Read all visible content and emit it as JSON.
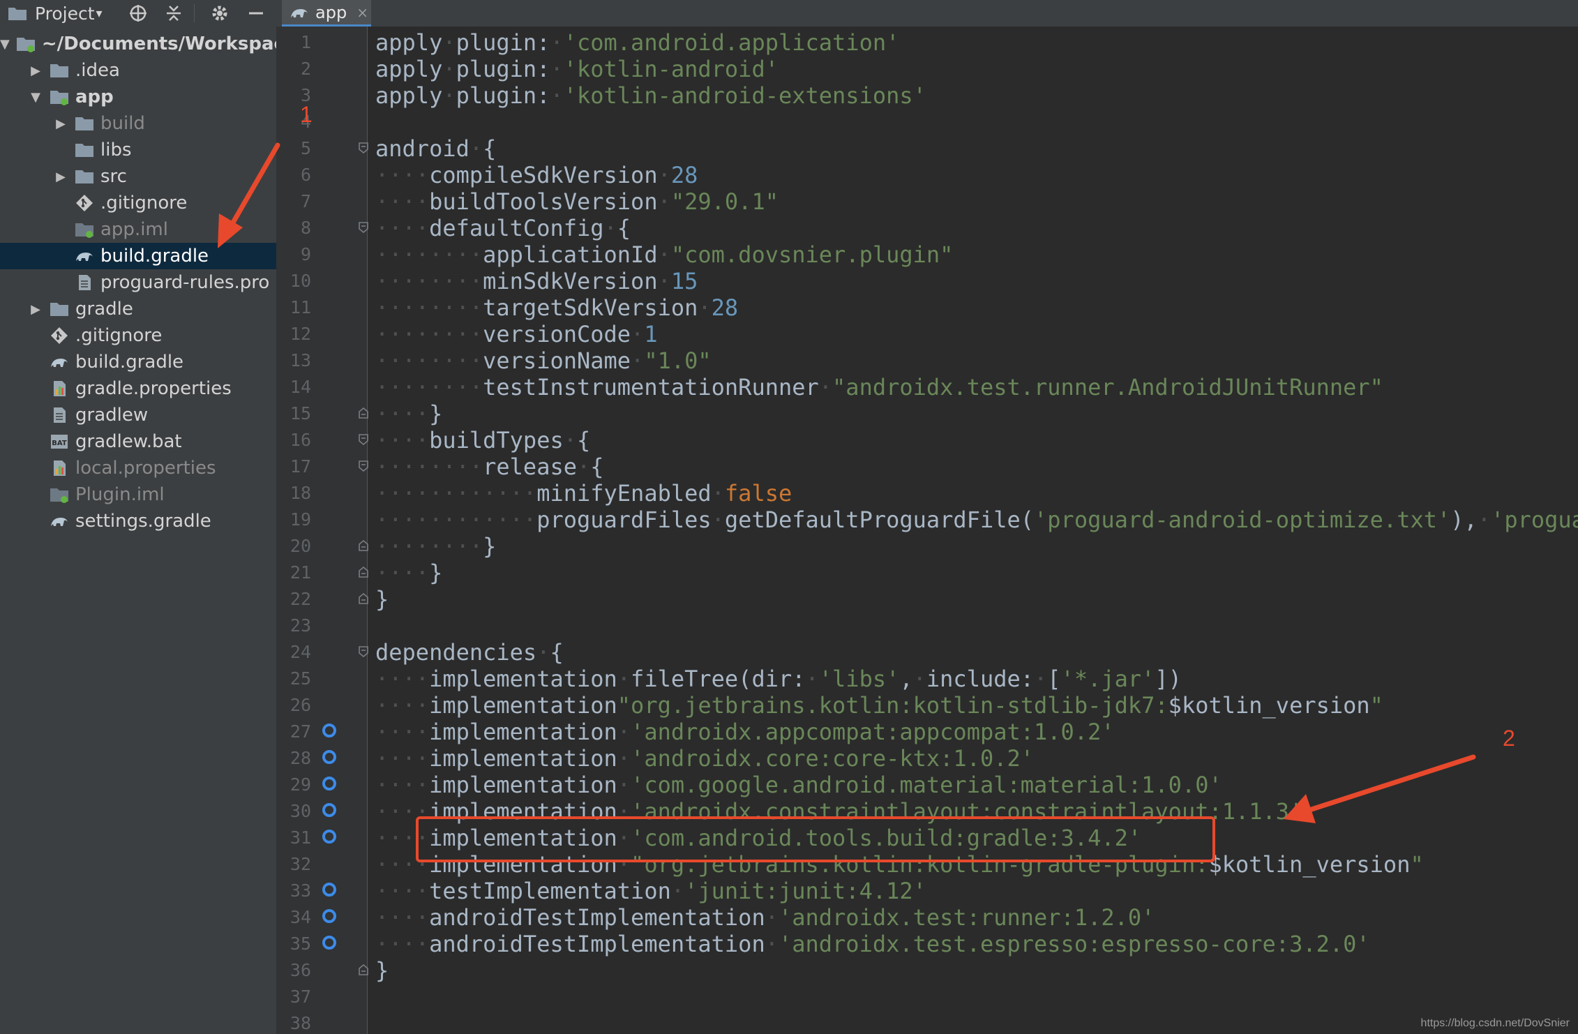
{
  "toolbar": {
    "project_label": "Project",
    "tab_label": "app",
    "tab_close": "×"
  },
  "tree": [
    {
      "label": "~/Documents/Workspace",
      "indent": 0,
      "arrow": "down",
      "icon": "folder-module-icon",
      "bold": true
    },
    {
      "label": ".idea",
      "indent": 1,
      "arrow": "right",
      "icon": "folder-icon"
    },
    {
      "label": "app",
      "indent": 1,
      "arrow": "down",
      "icon": "folder-module-icon",
      "bold": true
    },
    {
      "label": "build",
      "indent": 2,
      "arrow": "right",
      "icon": "folder-icon",
      "dim": true
    },
    {
      "label": "libs",
      "indent": 2,
      "arrow": "none",
      "icon": "folder-icon"
    },
    {
      "label": "src",
      "indent": 2,
      "arrow": "right",
      "icon": "folder-icon"
    },
    {
      "label": ".gitignore",
      "indent": 2,
      "arrow": "none",
      "icon": "git-icon"
    },
    {
      "label": "app.iml",
      "indent": 2,
      "arrow": "none",
      "icon": "iml-icon",
      "dim": true
    },
    {
      "label": "build.gradle",
      "indent": 2,
      "arrow": "none",
      "icon": "gradle-icon",
      "selected": true
    },
    {
      "label": "proguard-rules.pro",
      "indent": 2,
      "arrow": "none",
      "icon": "file-icon"
    },
    {
      "label": "gradle",
      "indent": 1,
      "arrow": "right",
      "icon": "folder-icon"
    },
    {
      "label": ".gitignore",
      "indent": 1,
      "arrow": "none",
      "icon": "git-icon"
    },
    {
      "label": "build.gradle",
      "indent": 1,
      "arrow": "none",
      "icon": "gradle-icon"
    },
    {
      "label": "gradle.properties",
      "indent": 1,
      "arrow": "none",
      "icon": "properties-icon"
    },
    {
      "label": "gradlew",
      "indent": 1,
      "arrow": "none",
      "icon": "file-icon"
    },
    {
      "label": "gradlew.bat",
      "indent": 1,
      "arrow": "none",
      "icon": "bat-icon"
    },
    {
      "label": "local.properties",
      "indent": 1,
      "arrow": "none",
      "icon": "properties-icon",
      "dim": true
    },
    {
      "label": "Plugin.iml",
      "indent": 1,
      "arrow": "none",
      "icon": "iml-icon",
      "dim": true
    },
    {
      "label": "settings.gradle",
      "indent": 1,
      "arrow": "none",
      "icon": "gradle-icon"
    }
  ],
  "code_lines": [
    {
      "n": "1",
      "tokens": [
        [
          "plain",
          "apply"
        ],
        [
          "ws",
          "·"
        ],
        [
          "plain",
          "plugin:"
        ],
        [
          "ws",
          "·"
        ],
        [
          "str",
          "'com.android.application'"
        ]
      ]
    },
    {
      "n": "2",
      "tokens": [
        [
          "plain",
          "apply"
        ],
        [
          "ws",
          "·"
        ],
        [
          "plain",
          "plugin:"
        ],
        [
          "ws",
          "·"
        ],
        [
          "str",
          "'kotlin-android'"
        ]
      ]
    },
    {
      "n": "3",
      "tokens": [
        [
          "plain",
          "apply"
        ],
        [
          "ws",
          "·"
        ],
        [
          "plain",
          "plugin:"
        ],
        [
          "ws",
          "·"
        ],
        [
          "str",
          "'kotlin-android-extensions'"
        ]
      ]
    },
    {
      "n": "4",
      "tokens": []
    },
    {
      "n": "5",
      "fold": "open",
      "tokens": [
        [
          "plain",
          "android"
        ],
        [
          "ws",
          "·"
        ],
        [
          "plain",
          "{"
        ]
      ]
    },
    {
      "n": "6",
      "tokens": [
        [
          "ws",
          "····"
        ],
        [
          "plain",
          "compileSdkVersion"
        ],
        [
          "ws",
          "·"
        ],
        [
          "num",
          "28"
        ]
      ]
    },
    {
      "n": "7",
      "tokens": [
        [
          "ws",
          "····"
        ],
        [
          "plain",
          "buildToolsVersion"
        ],
        [
          "ws",
          "·"
        ],
        [
          "str",
          "\"29.0.1\""
        ]
      ]
    },
    {
      "n": "8",
      "fold": "open",
      "tokens": [
        [
          "ws",
          "····"
        ],
        [
          "plain",
          "defaultConfig"
        ],
        [
          "ws",
          "·"
        ],
        [
          "plain",
          "{"
        ]
      ]
    },
    {
      "n": "9",
      "tokens": [
        [
          "ws",
          "········"
        ],
        [
          "plain",
          "applicationId"
        ],
        [
          "ws",
          "·"
        ],
        [
          "str",
          "\"com.dovsnier.plugin\""
        ]
      ]
    },
    {
      "n": "10",
      "tokens": [
        [
          "ws",
          "········"
        ],
        [
          "plain",
          "minSdkVersion"
        ],
        [
          "ws",
          "·"
        ],
        [
          "num",
          "15"
        ]
      ]
    },
    {
      "n": "11",
      "tokens": [
        [
          "ws",
          "········"
        ],
        [
          "plain",
          "targetSdkVersion"
        ],
        [
          "ws",
          "·"
        ],
        [
          "num",
          "28"
        ]
      ]
    },
    {
      "n": "12",
      "tokens": [
        [
          "ws",
          "········"
        ],
        [
          "plain",
          "versionCode"
        ],
        [
          "ws",
          "·"
        ],
        [
          "num",
          "1"
        ]
      ]
    },
    {
      "n": "13",
      "tokens": [
        [
          "ws",
          "········"
        ],
        [
          "plain",
          "versionName"
        ],
        [
          "ws",
          "·"
        ],
        [
          "str",
          "\"1.0\""
        ]
      ]
    },
    {
      "n": "14",
      "tokens": [
        [
          "ws",
          "········"
        ],
        [
          "plain",
          "testInstrumentationRunner"
        ],
        [
          "ws",
          "·"
        ],
        [
          "str",
          "\"androidx.test.runner.AndroidJUnitRunner\""
        ]
      ]
    },
    {
      "n": "15",
      "fold": "close",
      "tokens": [
        [
          "ws",
          "····"
        ],
        [
          "plain",
          "}"
        ]
      ]
    },
    {
      "n": "16",
      "fold": "open",
      "tokens": [
        [
          "ws",
          "····"
        ],
        [
          "plain",
          "buildTypes"
        ],
        [
          "ws",
          "·"
        ],
        [
          "plain",
          "{"
        ]
      ]
    },
    {
      "n": "17",
      "fold": "open",
      "tokens": [
        [
          "ws",
          "········"
        ],
        [
          "plain",
          "release"
        ],
        [
          "ws",
          "·"
        ],
        [
          "plain",
          "{"
        ]
      ]
    },
    {
      "n": "18",
      "tokens": [
        [
          "ws",
          "············"
        ],
        [
          "plain",
          "minifyEnabled"
        ],
        [
          "ws",
          "·"
        ],
        [
          "kw",
          "false"
        ]
      ]
    },
    {
      "n": "19",
      "tokens": [
        [
          "ws",
          "············"
        ],
        [
          "plain",
          "proguardFiles"
        ],
        [
          "ws",
          "·"
        ],
        [
          "plain",
          "getDefaultProguardFile("
        ],
        [
          "str",
          "'proguard-android-optimize.txt'"
        ],
        [
          "plain",
          "),"
        ],
        [
          "ws",
          "·"
        ],
        [
          "str",
          "'proguard-rules.pro'"
        ]
      ]
    },
    {
      "n": "20",
      "fold": "close",
      "tokens": [
        [
          "ws",
          "········"
        ],
        [
          "plain",
          "}"
        ]
      ]
    },
    {
      "n": "21",
      "fold": "close",
      "tokens": [
        [
          "ws",
          "····"
        ],
        [
          "plain",
          "}"
        ]
      ]
    },
    {
      "n": "22",
      "fold": "close",
      "tokens": [
        [
          "plain",
          "}"
        ]
      ]
    },
    {
      "n": "23",
      "tokens": []
    },
    {
      "n": "24",
      "fold": "open",
      "tokens": [
        [
          "plain",
          "dependencies"
        ],
        [
          "ws",
          "·"
        ],
        [
          "plain",
          "{"
        ]
      ]
    },
    {
      "n": "25",
      "tokens": [
        [
          "ws",
          "····"
        ],
        [
          "plain",
          "implementation"
        ],
        [
          "ws",
          "·"
        ],
        [
          "plain",
          "fileTree("
        ],
        [
          "plain",
          "dir:"
        ],
        [
          "ws",
          "·"
        ],
        [
          "str",
          "'libs'"
        ],
        [
          "plain",
          ","
        ],
        [
          "ws",
          "·"
        ],
        [
          "plain",
          "include:"
        ],
        [
          "ws",
          "·"
        ],
        [
          "plain",
          "["
        ],
        [
          "str",
          "'*.jar'"
        ],
        [
          "plain",
          "])"
        ]
      ]
    },
    {
      "n": "26",
      "tokens": [
        [
          "ws",
          "····"
        ],
        [
          "plain",
          "implementation"
        ],
        [
          "str",
          "\"org.jetbrains.kotlin:kotlin-stdlib-jdk7:"
        ],
        [
          "plain",
          "$kotlin_version"
        ],
        [
          "str",
          "\""
        ]
      ]
    },
    {
      "n": "27",
      "marker": true,
      "tokens": [
        [
          "ws",
          "····"
        ],
        [
          "plain",
          "implementation"
        ],
        [
          "ws",
          "·"
        ],
        [
          "str",
          "'androidx.appcompat:appcompat:1.0.2'"
        ]
      ]
    },
    {
      "n": "28",
      "marker": true,
      "tokens": [
        [
          "ws",
          "····"
        ],
        [
          "plain",
          "implementation"
        ],
        [
          "ws",
          "·"
        ],
        [
          "str",
          "'androidx.core:core-ktx:1.0.2'"
        ]
      ]
    },
    {
      "n": "29",
      "marker": true,
      "tokens": [
        [
          "ws",
          "····"
        ],
        [
          "plain",
          "implementation"
        ],
        [
          "ws",
          "·"
        ],
        [
          "str",
          "'com.google.android.material:material:1.0.0'"
        ]
      ]
    },
    {
      "n": "30",
      "marker": true,
      "tokens": [
        [
          "ws",
          "····"
        ],
        [
          "plain",
          "implementation"
        ],
        [
          "ws",
          "·"
        ],
        [
          "str",
          "'androidx.constraintlayout:constraintlayout:1.1.3'"
        ]
      ]
    },
    {
      "n": "31",
      "marker": true,
      "tokens": [
        [
          "ws",
          "····"
        ],
        [
          "plain",
          "implementation"
        ],
        [
          "ws",
          "·"
        ],
        [
          "str",
          "'com.android.tools.build:gradle:3.4.2'"
        ]
      ]
    },
    {
      "n": "32",
      "tokens": [
        [
          "ws",
          "····"
        ],
        [
          "plain",
          "implementation"
        ],
        [
          "ws",
          "·"
        ],
        [
          "str",
          "\"org.jetbrains.kotlin:kotlin-gradle-plugin:"
        ],
        [
          "plain",
          "$kotlin_version"
        ],
        [
          "str",
          "\""
        ]
      ]
    },
    {
      "n": "33",
      "marker": true,
      "tokens": [
        [
          "ws",
          "····"
        ],
        [
          "plain",
          "testImplementation"
        ],
        [
          "ws",
          "·"
        ],
        [
          "str",
          "'junit:junit:4.12'"
        ]
      ]
    },
    {
      "n": "34",
      "marker": true,
      "tokens": [
        [
          "ws",
          "····"
        ],
        [
          "plain",
          "androidTestImplementation"
        ],
        [
          "ws",
          "·"
        ],
        [
          "str",
          "'androidx.test:runner:1.2.0'"
        ]
      ]
    },
    {
      "n": "35",
      "marker": true,
      "tokens": [
        [
          "ws",
          "····"
        ],
        [
          "plain",
          "androidTestImplementation"
        ],
        [
          "ws",
          "·"
        ],
        [
          "str",
          "'androidx.test.espresso:espresso-core:3.2.0'"
        ]
      ]
    },
    {
      "n": "36",
      "fold": "close",
      "tokens": [
        [
          "plain",
          "}"
        ]
      ]
    },
    {
      "n": "37",
      "tokens": []
    },
    {
      "n": "38",
      "tokens": []
    }
  ],
  "annotations": {
    "label_1": "1",
    "label_2": "2",
    "color": "#e8492c"
  },
  "watermark": "https://blog.csdn.net/DovSnier",
  "colors": {
    "string": "#6a8759",
    "number": "#6897bb",
    "keyword": "#cc7832",
    "plain": "#a9b7c6",
    "marker": "#3d8be8"
  }
}
